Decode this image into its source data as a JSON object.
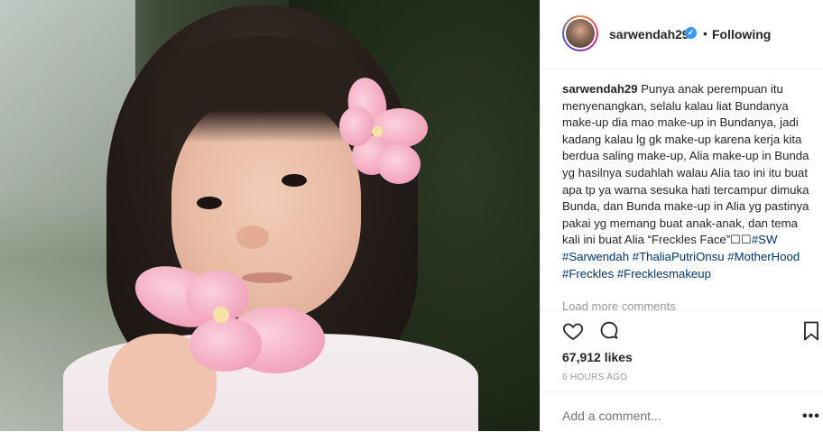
{
  "post": {
    "username": "sarwendah29",
    "verified_icon": "verified-badge-icon",
    "separator": "•",
    "following_label": "Following",
    "caption": {
      "user": "sarwendah29",
      "text": " Punya anak perempuan itu menyenangkan, selalu kalau liat Bundanya make-up dia mao make-up in Bundanya, jadi kadang kalau lg gk make-up karena kerja kita berdua saling make-up, Alia make-up in Bunda yg hasilnya sudahlah walau Alia tao ini itu buat apa tp ya warna sesuka hati tercampur dimuka Bunda, dan Bunda make-up in Alia yg pastinya pakai yg memang buat anak-anak, dan tema kali ini buat Alia “Freckles Face”",
      "boxes": "☐☐",
      "hashtags": [
        "#SW",
        "#Sarwendah",
        "#ThaliaPutriOnsu",
        "#MotherHood",
        "#Freckles",
        "#Frecklesmakeup"
      ]
    },
    "load_more": "Load more comments",
    "likes": "67,912 likes",
    "time_ago": "6 HOURS AGO",
    "add_comment_placeholder": "Add a comment...",
    "more_options": "•••"
  },
  "colors": {
    "text": "#262626",
    "hashtag": "#003569",
    "muted": "#999999",
    "verified": "#3897f0"
  }
}
